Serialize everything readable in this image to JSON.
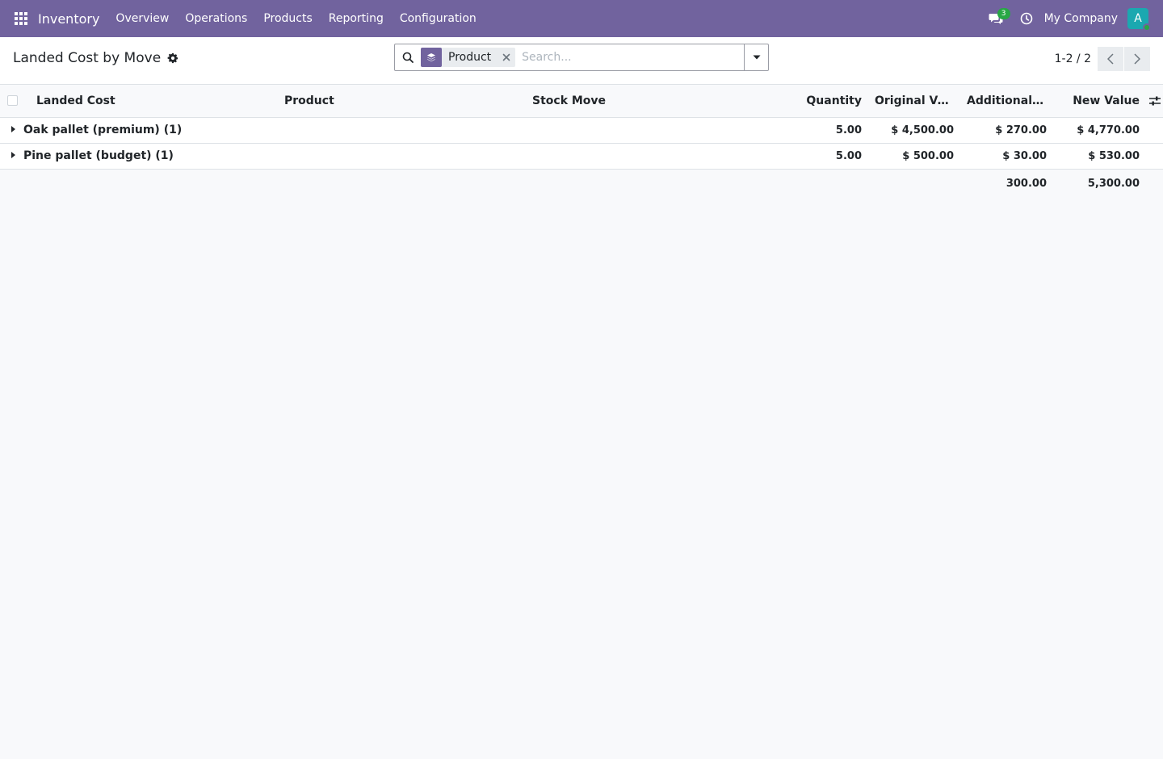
{
  "navbar": {
    "brand": "Inventory",
    "menu": [
      "Overview",
      "Operations",
      "Products",
      "Reporting",
      "Configuration"
    ],
    "chat_count": "3",
    "company": "My Company",
    "avatar_letter": "A",
    "color": "#71639e"
  },
  "control_panel": {
    "title": "Landed Cost by Move",
    "facet_label": "Product",
    "search_placeholder": "Search...",
    "pager": "1-2 / 2"
  },
  "table": {
    "columns": [
      "Landed Cost",
      "Product",
      "Stock Move",
      "Quantity",
      "Original Value",
      "Additional La...",
      "New Value"
    ],
    "groups": [
      {
        "label": "Oak pallet (premium) (1)",
        "quantity": "5.00",
        "original_value": "$ 4,500.00",
        "additional": "$ 270.00",
        "new_value": "$ 4,770.00"
      },
      {
        "label": "Pine pallet (budget) (1)",
        "quantity": "5.00",
        "original_value": "$ 500.00",
        "additional": "$ 30.00",
        "new_value": "$ 530.00"
      }
    ],
    "totals": {
      "additional": "300.00",
      "new_value": "5,300.00"
    }
  }
}
